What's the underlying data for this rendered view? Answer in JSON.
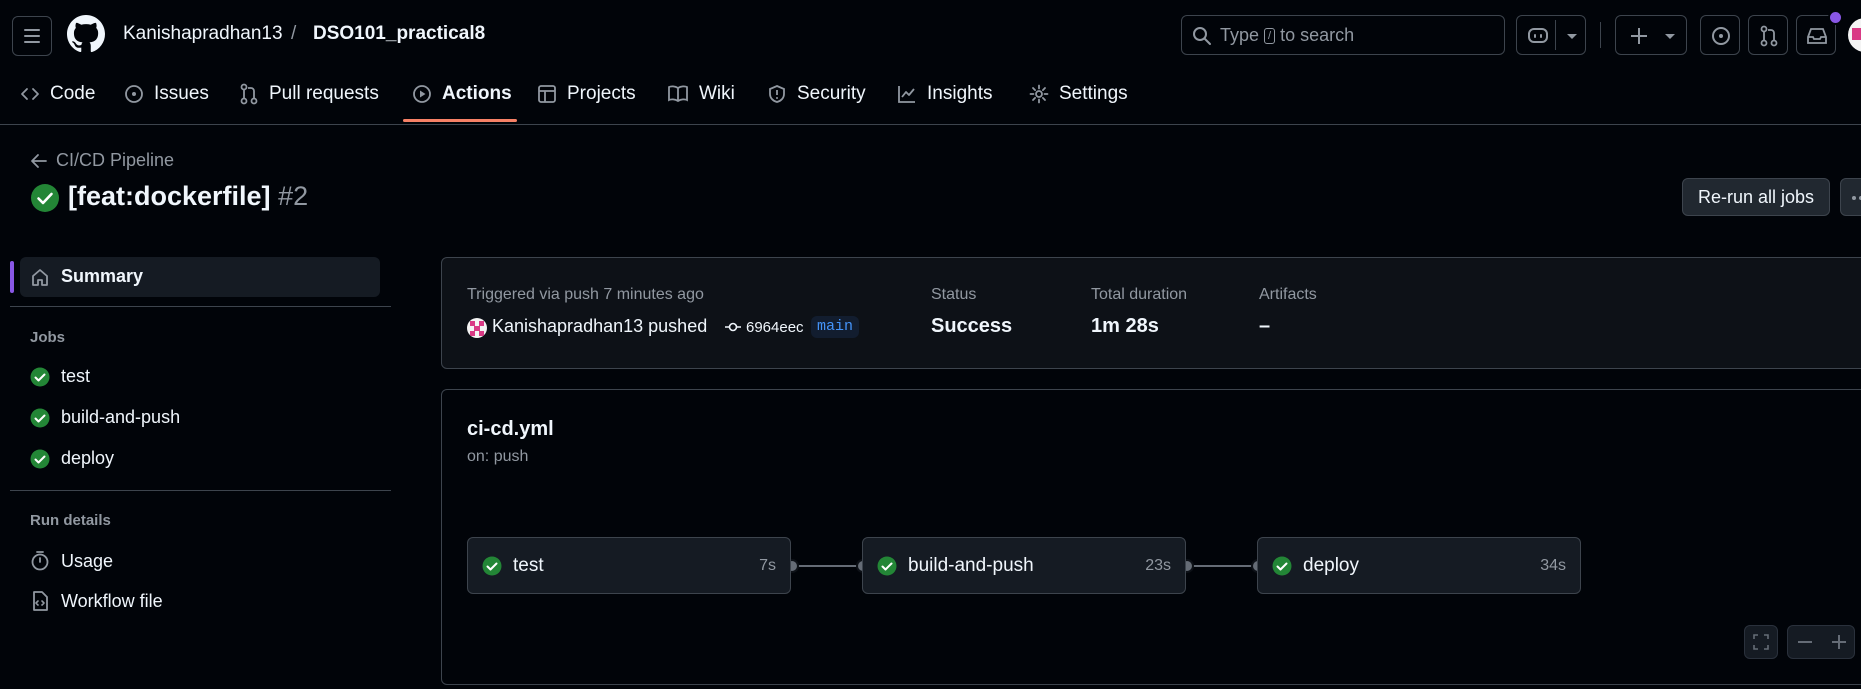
{
  "header": {
    "owner": "Kanishapradhan13",
    "separator": "/",
    "repo": "DSO101_practical8",
    "search": {
      "prefix": "Type",
      "key": "/",
      "suffix": "to search"
    }
  },
  "tabs": [
    {
      "label": "Code",
      "icon": "code-icon"
    },
    {
      "label": "Issues",
      "icon": "issue-opened-icon"
    },
    {
      "label": "Pull requests",
      "icon": "git-pull-request-icon"
    },
    {
      "label": "Actions",
      "icon": "play-icon",
      "active": true
    },
    {
      "label": "Projects",
      "icon": "table-icon"
    },
    {
      "label": "Wiki",
      "icon": "book-icon"
    },
    {
      "label": "Security",
      "icon": "shield-icon"
    },
    {
      "label": "Insights",
      "icon": "graph-icon"
    },
    {
      "label": "Settings",
      "icon": "gear-icon"
    }
  ],
  "run": {
    "back_label": "CI/CD Pipeline",
    "title": "[feat:dockerfile]",
    "number": "#2",
    "rerun_label": "Re-run all jobs"
  },
  "sidebar": {
    "summary_label": "Summary",
    "jobs_heading": "Jobs",
    "jobs": [
      "test",
      "build-and-push",
      "deploy"
    ],
    "run_details_heading": "Run details",
    "usage_label": "Usage",
    "workflow_file_label": "Workflow file"
  },
  "summary": {
    "triggered": "Triggered via push 7 minutes ago",
    "actor": "Kanishapradhan13",
    "action": "pushed",
    "commit": "6964eec",
    "branch": "main",
    "status_label": "Status",
    "status_value": "Success",
    "duration_label": "Total duration",
    "duration_value": "1m 28s",
    "artifacts_label": "Artifacts",
    "artifacts_value": "–"
  },
  "workflow": {
    "file": "ci-cd.yml",
    "trigger": "on: push",
    "jobs": [
      {
        "name": "test",
        "duration": "7s"
      },
      {
        "name": "build-and-push",
        "duration": "23s"
      },
      {
        "name": "deploy",
        "duration": "34s"
      }
    ]
  },
  "colors": {
    "success": "#238636",
    "accent_underline": "#f78166",
    "selected_bar": "#8957e5",
    "link": "#4493f8",
    "notification_dot": "#8957e5"
  }
}
